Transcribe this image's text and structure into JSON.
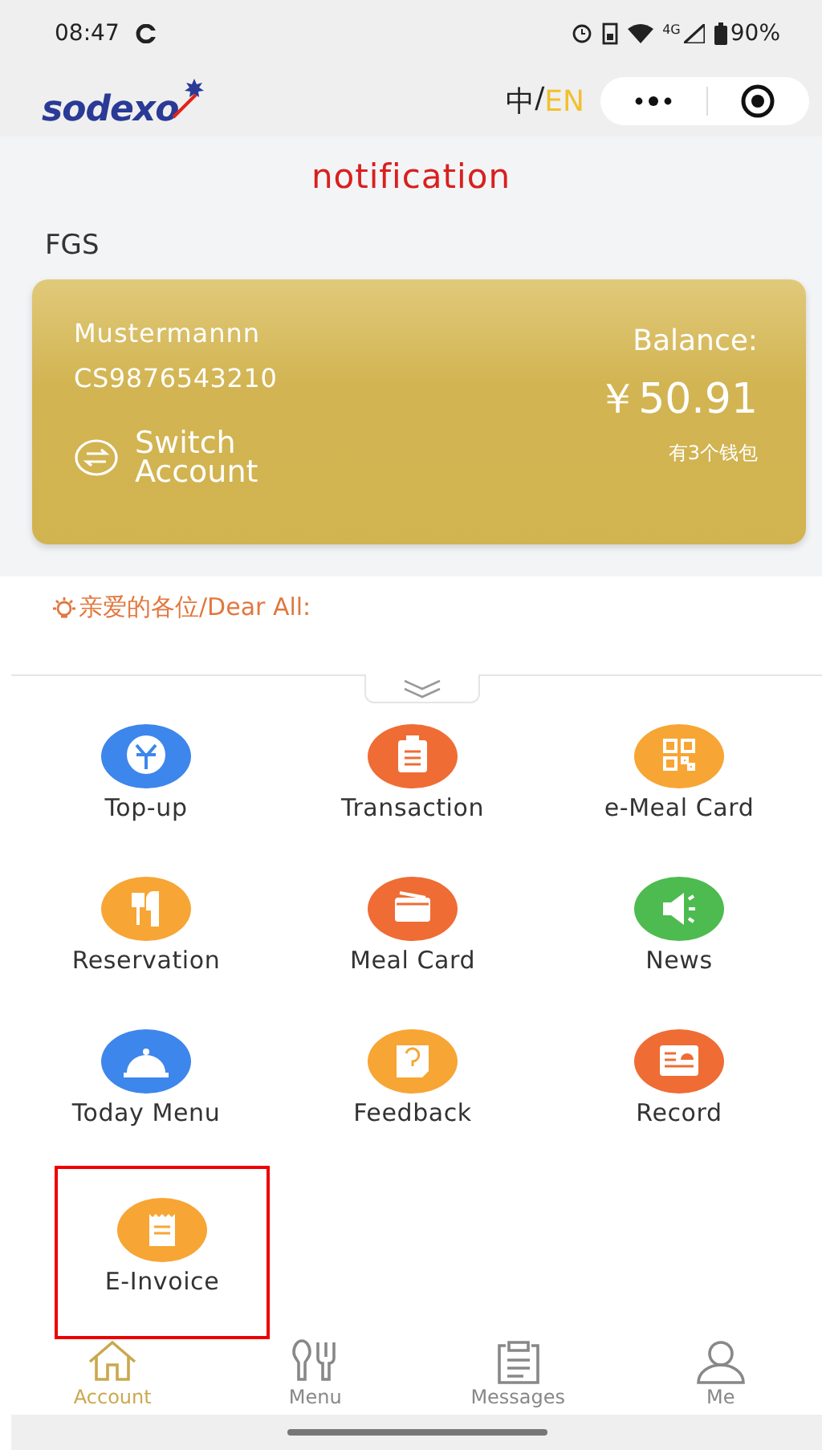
{
  "status_bar": {
    "time": "08:47",
    "network": "4G",
    "battery": "90%"
  },
  "header": {
    "logo": "sodexo",
    "lang_zh": "中",
    "lang_sep": "/",
    "lang_en": "EN",
    "lang_en_selected": true
  },
  "page_title": "notification",
  "site": "FGS",
  "account_card": {
    "name": "Mustermannn",
    "card_number": "CS9876543210",
    "switch_label": "Switch Account",
    "balance_label": "Balance:",
    "balance": "￥50.91",
    "wallets": "有3个钱包"
  },
  "notice": {
    "text": "亲爱的各位/Dear All:"
  },
  "features": [
    {
      "label": "Top-up",
      "kind": "topup",
      "color": "#3d86ec",
      "highlighted": false
    },
    {
      "label": "Transaction",
      "kind": "clipboard",
      "color": "#ef6c35",
      "highlighted": false
    },
    {
      "label": "e-Meal Card",
      "kind": "qr",
      "color": "#f7a534",
      "highlighted": false
    },
    {
      "label": "Reservation",
      "kind": "cutlery",
      "color": "#f7a534",
      "highlighted": false
    },
    {
      "label": "Meal Card",
      "kind": "card",
      "color": "#ef6c35",
      "highlighted": false
    },
    {
      "label": "News",
      "kind": "speaker",
      "color": "#4dbb4f",
      "highlighted": false
    },
    {
      "label": "Today Menu",
      "kind": "cloche",
      "color": "#3d86ec",
      "highlighted": false
    },
    {
      "label": "Feedback",
      "kind": "question",
      "color": "#f7a534",
      "highlighted": false
    },
    {
      "label": "Record",
      "kind": "record",
      "color": "#ef6c35",
      "highlighted": false
    },
    {
      "label": "E-Invoice",
      "kind": "receipt",
      "color": "#f7a534",
      "highlighted": true
    }
  ],
  "tabs": [
    {
      "label": "Account",
      "kind": "home",
      "selected": true
    },
    {
      "label": "Menu",
      "kind": "cutlery",
      "selected": false
    },
    {
      "label": "Messages",
      "kind": "notes",
      "selected": false
    },
    {
      "label": "Me",
      "kind": "person",
      "selected": false
    }
  ]
}
